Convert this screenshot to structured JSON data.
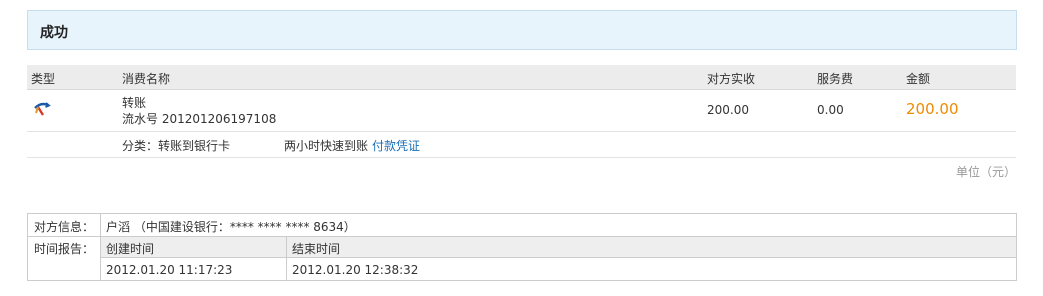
{
  "status": {
    "title": "成功"
  },
  "table": {
    "headers": {
      "type": "类型",
      "name": "消费名称",
      "actual": "对方实收",
      "fee": "服务费",
      "amount": "金额"
    },
    "row": {
      "type_icon": "transfer-icon",
      "name": "转账",
      "serial": "流水号 201201206197108",
      "actual": "200.00",
      "fee": "0.00",
      "amount": "200.00"
    },
    "sub": {
      "category": "分类：转账到银行卡",
      "speed": "两小时快速到账",
      "voucher_link": "付款凭证"
    },
    "unit": "单位（元）"
  },
  "info": {
    "counterpart_label": "对方信息：",
    "counterpart_value": "户滔 （中国建设银行：**** **** **** 8634）",
    "time_label": "时间报告：",
    "time_headers": [
      "创建时间",
      "结束时间"
    ],
    "time_values": [
      "2012.01.20 11:17:23",
      "2012.01.20 12:38:32"
    ]
  },
  "colors": {
    "amount": "#f08a00",
    "link": "#1a6fb6",
    "status_bg": "#e8f4fc"
  }
}
